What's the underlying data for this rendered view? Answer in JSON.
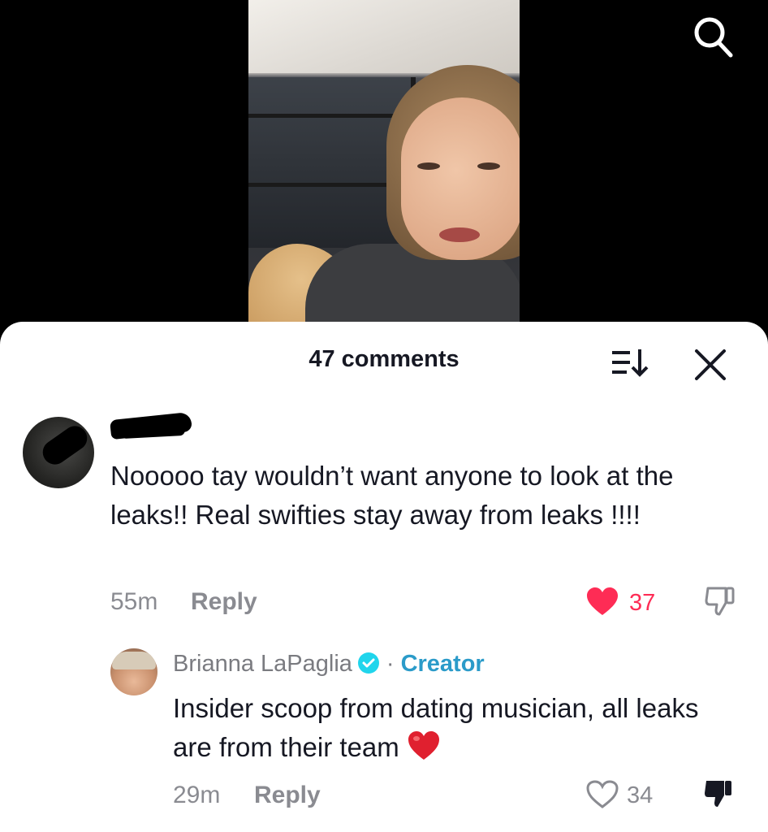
{
  "header": {
    "comments_count_label": "47 comments"
  },
  "comments": [
    {
      "text": "Nooooo tay wouldn’t want anyone to look at the leaks!! Real swifties stay away from leaks !!!!",
      "time": "55m",
      "reply_label": "Reply",
      "like_count": "37",
      "liked": true
    }
  ],
  "reply": {
    "author": "Brianna LaPaglia",
    "badge": "Creator",
    "separator": "·",
    "text": "Insider scoop from dating musician, all leaks are from their team",
    "time": "29m",
    "reply_label": "Reply",
    "like_count": "34",
    "liked": false
  },
  "colors": {
    "like_red": "#fe2c55",
    "creator_blue": "#2b9bc9",
    "muted_text": "#8a8b91",
    "verified_blue": "#20d5ec"
  },
  "icons": [
    "search-icon",
    "sort-icon",
    "close-icon",
    "heart-icon",
    "thumbs-down-icon",
    "verified-icon",
    "heart-emoji-icon"
  ]
}
